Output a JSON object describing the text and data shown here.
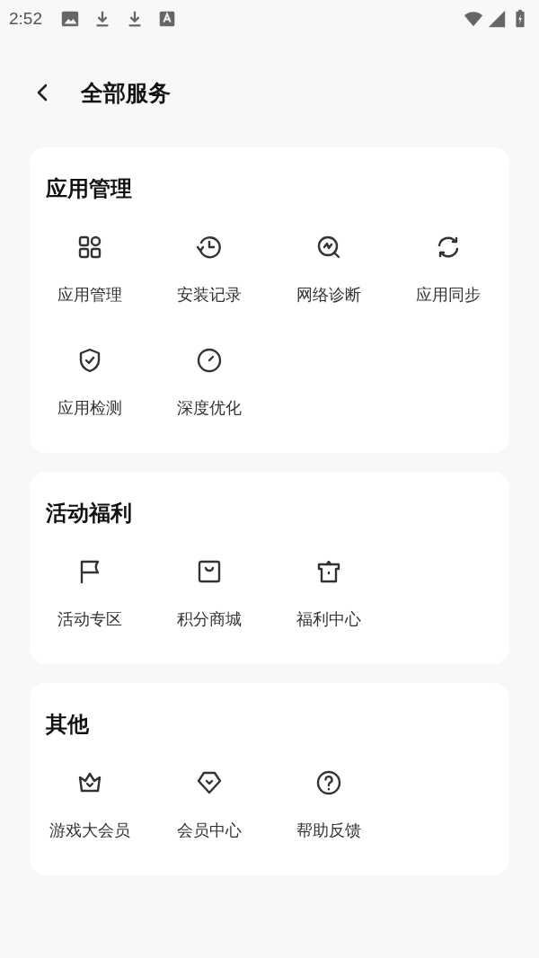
{
  "status_bar": {
    "time": "2:52",
    "notification_icons": [
      {
        "kind": "image"
      },
      {
        "kind": "download"
      },
      {
        "kind": "download"
      },
      {
        "kind": "font"
      }
    ],
    "system_icons": [
      {
        "kind": "wifi"
      },
      {
        "kind": "signal"
      },
      {
        "kind": "battery"
      }
    ]
  },
  "header": {
    "title": "全部服务"
  },
  "sections": [
    {
      "title": "应用管理",
      "items": [
        {
          "label": "应用管理",
          "kind": "grid"
        },
        {
          "label": "安装记录",
          "kind": "history"
        },
        {
          "label": "网络诊断",
          "kind": "diagnose"
        },
        {
          "label": "应用同步",
          "kind": "sync"
        },
        {
          "label": "应用检测",
          "kind": "shield"
        },
        {
          "label": "深度优化",
          "kind": "gauge"
        }
      ]
    },
    {
      "title": "活动福利",
      "items": [
        {
          "label": "活动专区",
          "kind": "flag"
        },
        {
          "label": "积分商城",
          "kind": "bag"
        },
        {
          "label": "福利中心",
          "kind": "gift"
        }
      ]
    },
    {
      "title": "其他",
      "items": [
        {
          "label": "游戏大会员",
          "kind": "crown"
        },
        {
          "label": "会员中心",
          "kind": "gem"
        },
        {
          "label": "帮助反馈",
          "kind": "help"
        }
      ]
    }
  ]
}
